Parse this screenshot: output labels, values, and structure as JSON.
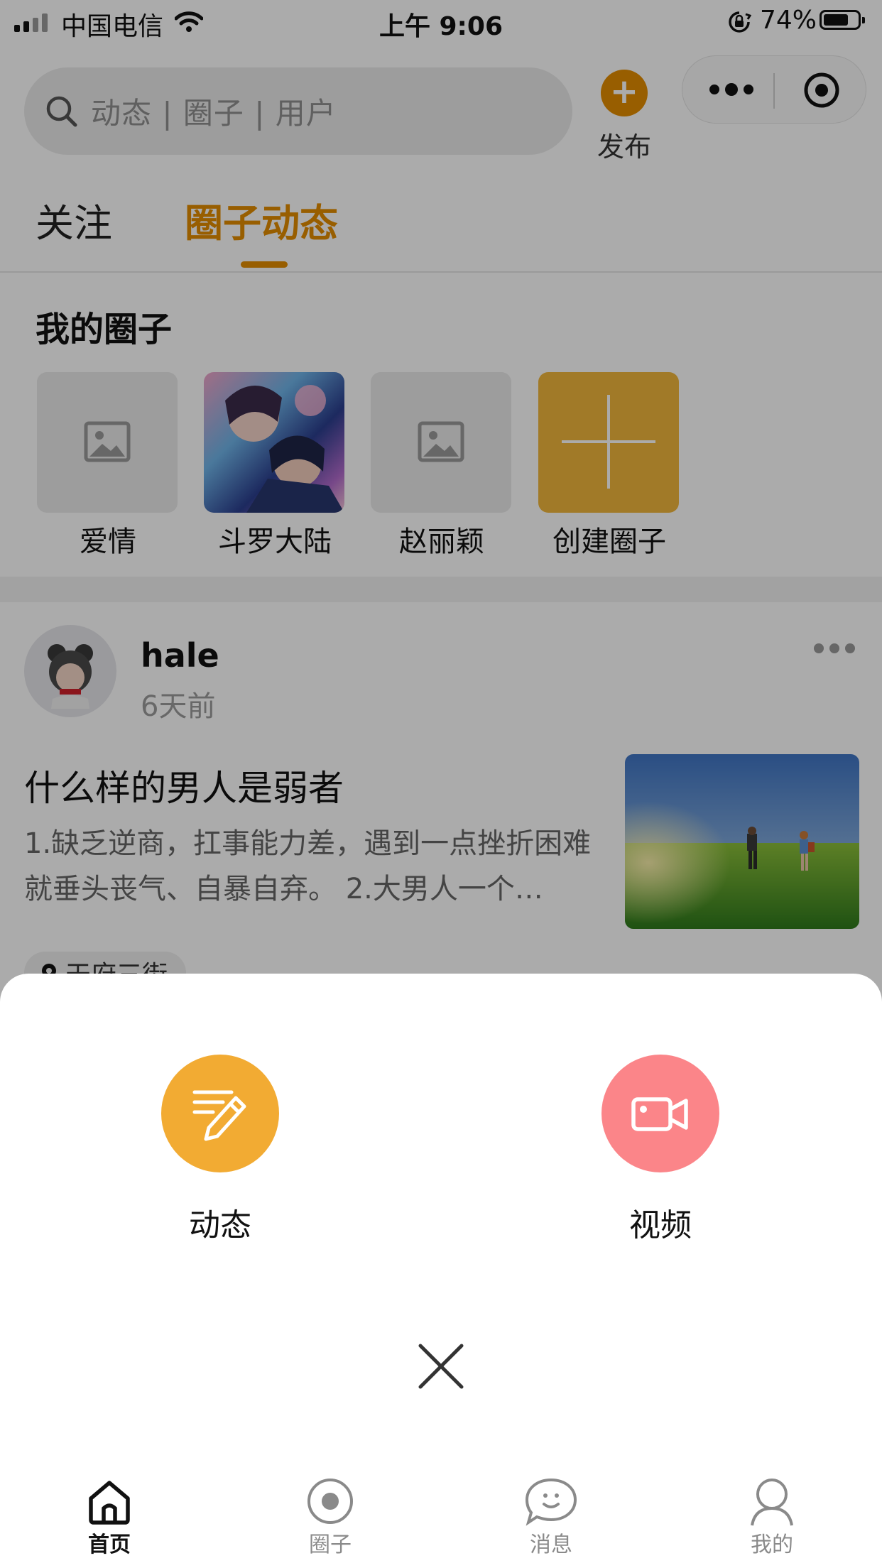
{
  "status_bar": {
    "carrier": "中国电信",
    "time": "上午 9:06",
    "battery_percent": "74%",
    "battery_level": 0.74,
    "icons": [
      "signal-icon",
      "wifi-icon",
      "orientation-lock-icon",
      "battery-icon"
    ]
  },
  "header": {
    "search_placeholder": "动态 | 圈子 | 用户",
    "publish_label": "发布",
    "capsule_icons": [
      "more-dots-icon",
      "target-close-icon"
    ]
  },
  "tabs": [
    {
      "label": "关注",
      "active": false
    },
    {
      "label": "圈子动态",
      "active": true
    }
  ],
  "my_circles": {
    "title": "我的圈子",
    "items": [
      {
        "name": "爱情",
        "thumb": "image-placeholder-icon"
      },
      {
        "name": "斗罗大陆",
        "thumb": "anime-artwork"
      },
      {
        "name": "赵丽颖",
        "thumb": "image-placeholder-icon"
      },
      {
        "name": "创建圈子",
        "thumb": "plus-icon"
      }
    ]
  },
  "post": {
    "username": "hale",
    "time_ago": "6天前",
    "title": "什么样的男人是弱者",
    "excerpt": "1.缺乏逆商，扛事能力差，遇到一点挫折困难就垂头丧气、自暴自弃。 2.大男人一个…",
    "location": "天府三街"
  },
  "publish_sheet": {
    "actions": [
      {
        "label": "动态",
        "icon": "pencil-note-icon",
        "color": "#f2ab33"
      },
      {
        "label": "视频",
        "icon": "video-camera-icon",
        "color": "#fb8589"
      }
    ],
    "close_icon": "close-icon"
  },
  "tab_bar": [
    {
      "label": "首页",
      "icon": "home-icon",
      "active": true
    },
    {
      "label": "圈子",
      "icon": "circle-dot-icon",
      "active": false
    },
    {
      "label": "消息",
      "icon": "chat-smile-icon",
      "active": false
    },
    {
      "label": "我的",
      "icon": "user-icon",
      "active": false
    }
  ],
  "colors": {
    "accent": "#e38c00",
    "mask": "rgba(0,0,0,0.33)"
  }
}
